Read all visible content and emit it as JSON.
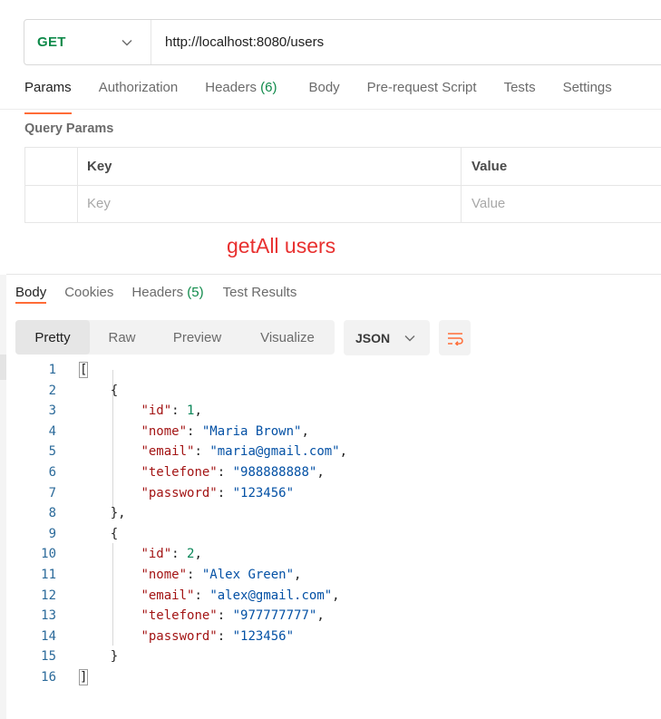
{
  "request": {
    "method": "GET",
    "url": "http://localhost:8080/users"
  },
  "request_tabs": [
    {
      "label": "Params",
      "count": "",
      "active": true
    },
    {
      "label": "Authorization",
      "count": "",
      "active": false
    },
    {
      "label": "Headers",
      "count": "(6)",
      "active": false
    },
    {
      "label": "Body",
      "count": "",
      "active": false
    },
    {
      "label": "Pre-request Script",
      "count": "",
      "active": false
    },
    {
      "label": "Tests",
      "count": "",
      "active": false
    },
    {
      "label": "Settings",
      "count": "",
      "active": false
    }
  ],
  "query_params": {
    "title": "Query Params",
    "key_header": "Key",
    "value_header": "Value",
    "key_placeholder": "Key",
    "value_placeholder": "Value"
  },
  "annotation": "getAll users",
  "response_tabs": [
    {
      "label": "Body",
      "count": "",
      "active": true
    },
    {
      "label": "Cookies",
      "count": "",
      "active": false
    },
    {
      "label": "Headers",
      "count": "(5)",
      "active": false
    },
    {
      "label": "Test Results",
      "count": "",
      "active": false
    }
  ],
  "view_modes": [
    "Pretty",
    "Raw",
    "Preview",
    "Visualize"
  ],
  "active_view": "Pretty",
  "format": "JSON",
  "colors": {
    "accent": "#ff6c37",
    "method": "#0f8a4a",
    "annotation": "#e8302f"
  },
  "icons": {
    "method_dropdown": "chevron-down-icon",
    "format_dropdown": "chevron-down-icon",
    "wrap": "wrap-lines-icon"
  },
  "response_body": [
    {
      "n": "1",
      "text": "["
    },
    {
      "n": "2",
      "text": "    {"
    },
    {
      "n": "3",
      "text": "        \"id\": 1,"
    },
    {
      "n": "4",
      "text": "        \"nome\": \"Maria Brown\","
    },
    {
      "n": "5",
      "text": "        \"email\": \"maria@gmail.com\","
    },
    {
      "n": "6",
      "text": "        \"telefone\": \"988888888\","
    },
    {
      "n": "7",
      "text": "        \"password\": \"123456\""
    },
    {
      "n": "8",
      "text": "    },"
    },
    {
      "n": "9",
      "text": "    {"
    },
    {
      "n": "10",
      "text": "        \"id\": 2,"
    },
    {
      "n": "11",
      "text": "        \"nome\": \"Alex Green\","
    },
    {
      "n": "12",
      "text": "        \"email\": \"alex@gmail.com\","
    },
    {
      "n": "13",
      "text": "        \"telefone\": \"977777777\","
    },
    {
      "n": "14",
      "text": "        \"password\": \"123456\""
    },
    {
      "n": "15",
      "text": "    }"
    },
    {
      "n": "16",
      "text": "]"
    }
  ]
}
